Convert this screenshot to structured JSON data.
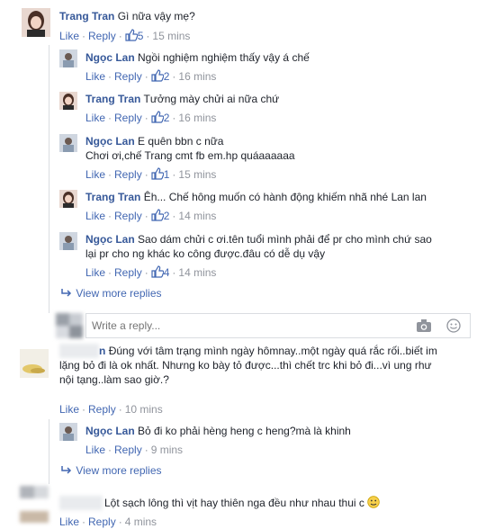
{
  "like": "Like",
  "reply": "Reply",
  "c1": {
    "name": "Trang Tran",
    "text": "Gì nữa vậy mẹ?",
    "likes": "5",
    "time": "15 mins"
  },
  "r1": {
    "name": "Ngọc Lan",
    "text": "Ngồi nghiệm nghiệm thấy vậy á chế",
    "likes": "2",
    "time": "16 mins"
  },
  "r2": {
    "name": "Trang Tran",
    "text": "Tưởng mày chửi ai nữa chứ",
    "likes": "2",
    "time": "16 mins"
  },
  "r3": {
    "name": "Ngọc Lan",
    "text": "E quên bbn c nữa",
    "text2": "Chơi ơi,chế Trang cmt fb em.hp quáaaaaaa",
    "likes": "1",
    "time": "15 mins"
  },
  "r4": {
    "name": "Trang Tran",
    "text": "Êh... Chế hông muốn có hành động khiếm nhã nhé Lan lan",
    "likes": "2",
    "time": "14 mins"
  },
  "r5": {
    "name": "Ngọc Lan",
    "text": "Sao dám chửi c ơi.tên tuổi mình phải để pr cho mình chứ sao",
    "text2": "lại pr cho ng khác ko công được.đâu có dễ dụ vậy",
    "likes": "4",
    "time": "14 mins"
  },
  "view_more_1": "View more replies",
  "reply_placeholder": "Write a reply...",
  "c2": {
    "name_fragment": "n",
    "text": "Đúng với tâm trạng mình ngày hômnay..một ngày quá rắc rối..biết im",
    "text2": "lặng bỏ đi là ok nhất. Nhưng ko bày tỏ được...thì chết trc khi bỏ đi...vì ung rhư",
    "text3": "nội tạng..làm sao giờ.?",
    "time": "10 mins"
  },
  "r6": {
    "name": "Ngọc Lan",
    "text": "Bỏ đi ko phải hèng heng c heng?mà là khinh",
    "time": "9 mins"
  },
  "view_more_2": "View more replies",
  "c3": {
    "text": "Lột sạch lông thì vịt hay thiên nga đều như nhau thui c",
    "time": "4 mins"
  },
  "colors": {
    "link": "#4267b2",
    "name": "#365899",
    "meta": "#90949c"
  }
}
